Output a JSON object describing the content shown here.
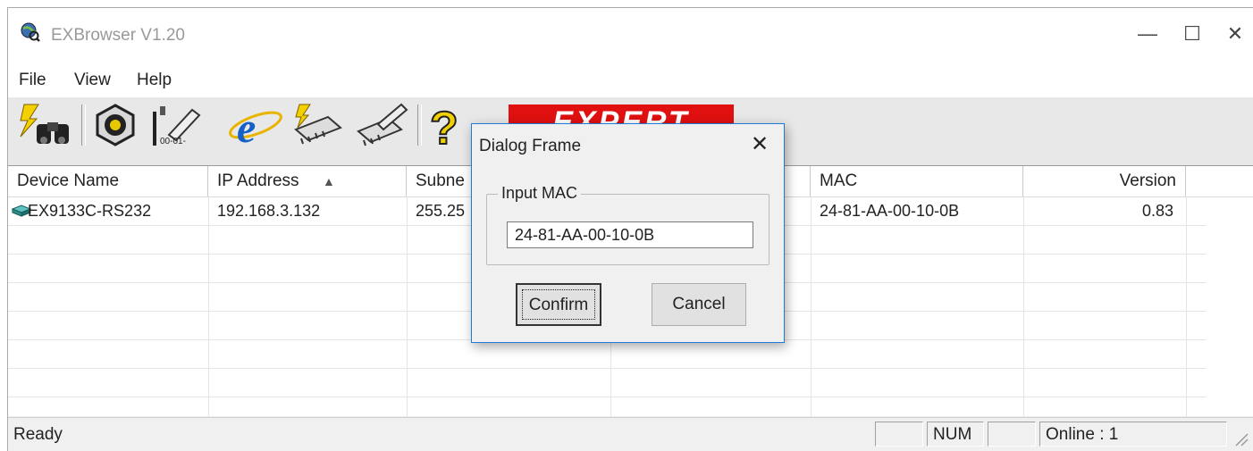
{
  "window": {
    "title": "EXBrowser V1.20",
    "controls": {
      "minimize": "—",
      "maximize": "☐",
      "close": "✕"
    }
  },
  "menu": [
    "File",
    "View",
    "Help"
  ],
  "toolbar": {
    "icons": [
      "search-binoculars-icon",
      "network-device-icon",
      "edit-mac-icon",
      "internet-explorer-icon",
      "firmware-chip-icon",
      "edit-chip-icon",
      "help-icon"
    ],
    "logo_text": "EXPERT"
  },
  "table": {
    "columns": [
      "Device Name",
      "IP Address",
      "Subne",
      "",
      "MAC",
      "Version"
    ],
    "sort_indicator": "▲",
    "rows": [
      {
        "device_name": "EX9133C-RS232",
        "ip": "192.168.3.132",
        "subnet": "255.25",
        "mac": "24-81-AA-00-10-0B",
        "version": "0.83"
      }
    ]
  },
  "status": {
    "left": "Ready",
    "num": "NUM",
    "online": "Online : 1"
  },
  "dialog": {
    "title": "Dialog Frame",
    "close": "✕",
    "group_label": "Input MAC",
    "mac_value": "24-81-AA-00-10-0B",
    "confirm_label": "Confirm",
    "cancel_label": "Cancel"
  },
  "colors": {
    "accent": "#1e7bd7",
    "logo_bg": "#e01010"
  }
}
